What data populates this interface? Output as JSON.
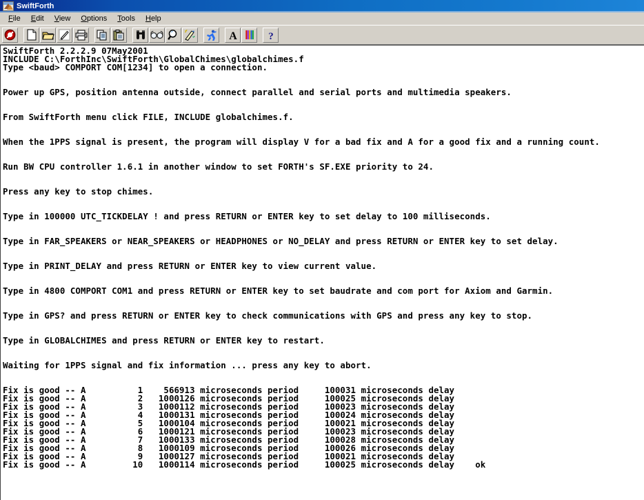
{
  "window": {
    "title": "SwiftForth",
    "icon": "swift-bird-icon"
  },
  "menubar": {
    "items": [
      {
        "label": "File",
        "accel": "F"
      },
      {
        "label": "Edit",
        "accel": "E"
      },
      {
        "label": "View",
        "accel": "V"
      },
      {
        "label": "Options",
        "accel": "O"
      },
      {
        "label": "Tools",
        "accel": "T"
      },
      {
        "label": "Help",
        "accel": "H"
      }
    ]
  },
  "toolbar": {
    "buttons": [
      {
        "name": "abort-icon",
        "tip": "Abort"
      },
      {
        "name": "new-file-icon",
        "tip": "New"
      },
      {
        "name": "open-folder-icon",
        "tip": "Open"
      },
      {
        "name": "edit-pencil-icon",
        "tip": "Edit"
      },
      {
        "name": "print-icon",
        "tip": "Print"
      },
      {
        "name": "copy-icon",
        "tip": "Copy"
      },
      {
        "name": "paste-icon",
        "tip": "Paste"
      },
      {
        "name": "find-binoculars-icon",
        "tip": "Find"
      },
      {
        "name": "view-glasses-icon",
        "tip": "View"
      },
      {
        "name": "locate-magnifier-icon",
        "tip": "Locate"
      },
      {
        "name": "wand-icon",
        "tip": "Tools"
      },
      {
        "name": "run-person-icon",
        "tip": "Run"
      },
      {
        "name": "font-letter-a-icon",
        "tip": "Font"
      },
      {
        "name": "colors-bars-icon",
        "tip": "Colors"
      },
      {
        "name": "help-question-icon",
        "tip": "Help"
      }
    ]
  },
  "terminal": {
    "lines": [
      "SwiftForth 2.2.2.9 07May2001",
      "INCLUDE C:\\ForthInc\\SwiftForth\\GlobalChimes\\globalchimes.f",
      "Type <baud> COMPORT COM[1234] to open a connection.",
      "",
      "",
      "Power up GPS, position antenna outside, connect parallel and serial ports and multimedia speakers.",
      "",
      "",
      "From SwiftForth menu click FILE, INCLUDE globalchimes.f.",
      "",
      "",
      "When the 1PPS signal is present, the program will display V for a bad fix and A for a good fix and a running count.",
      "",
      "",
      "Run BW CPU controller 1.6.1 in another window to set FORTH's SF.EXE priority to 24.",
      "",
      "",
      "Press any key to stop chimes.",
      "",
      "",
      "Type in 100000 UTC_TICKDELAY ! and press RETURN or ENTER key to set delay to 100 milliseconds.",
      "",
      "",
      "Type in FAR_SPEAKERS or NEAR_SPEAKERS or HEADPHONES or NO_DELAY and press RETURN or ENTER key to set delay.",
      "",
      "",
      "Type in PRINT_DELAY and press RETURN or ENTER key to view current value.",
      "",
      "",
      "Type in 4800 COMPORT COM1 and press RETURN or ENTER key to set baudrate and com port for Axiom and Garmin.",
      "",
      "",
      "Type in GPS? and press RETURN or ENTER key to check communications with GPS and press any key to stop.",
      "",
      "",
      "Type in GLOBALCHIMES and press RETURN or ENTER key to restart.",
      "",
      "",
      "Waiting for 1PPS signal and fix information ... press any key to abort.",
      "",
      "",
      "Fix is good -- A          1    566913 microseconds period     100031 microseconds delay",
      "Fix is good -- A          2   1000126 microseconds period     100025 microseconds delay",
      "Fix is good -- A          3   1000112 microseconds period     100023 microseconds delay",
      "Fix is good -- A          4   1000131 microseconds period     100024 microseconds delay",
      "Fix is good -- A          5   1000104 microseconds period     100021 microseconds delay",
      "Fix is good -- A          6   1000121 microseconds period     100023 microseconds delay",
      "Fix is good -- A          7   1000133 microseconds period     100028 microseconds delay",
      "Fix is good -- A          8   1000109 microseconds period     100026 microseconds delay",
      "Fix is good -- A          9   1000127 microseconds period     100021 microseconds delay",
      "Fix is good -- A         10   1000114 microseconds period     100025 microseconds delay    ok"
    ],
    "fix_log": {
      "status_text": "Fix is good -- A",
      "columns": [
        "status",
        "count",
        "period_us",
        "period_label",
        "delay_us",
        "delay_label"
      ],
      "rows": [
        {
          "count": 1,
          "period_us": 566913,
          "delay_us": 100031
        },
        {
          "count": 2,
          "period_us": 1000126,
          "delay_us": 100025
        },
        {
          "count": 3,
          "period_us": 1000112,
          "delay_us": 100023
        },
        {
          "count": 4,
          "period_us": 1000131,
          "delay_us": 100024
        },
        {
          "count": 5,
          "period_us": 1000104,
          "delay_us": 100021
        },
        {
          "count": 6,
          "period_us": 1000121,
          "delay_us": 100023
        },
        {
          "count": 7,
          "period_us": 1000133,
          "delay_us": 100028
        },
        {
          "count": 8,
          "period_us": 1000109,
          "delay_us": 100026
        },
        {
          "count": 9,
          "period_us": 1000127,
          "delay_us": 100021
        },
        {
          "count": 10,
          "period_us": 1000114,
          "delay_us": 100025
        }
      ],
      "prompt_ok": "ok"
    }
  },
  "colors": {
    "title_bar_start": "#0a2a8c",
    "title_bar_end": "#1d84d8",
    "chrome": "#d4d0c8",
    "terminal_bg": "#ffffff",
    "terminal_fg": "#000000"
  }
}
